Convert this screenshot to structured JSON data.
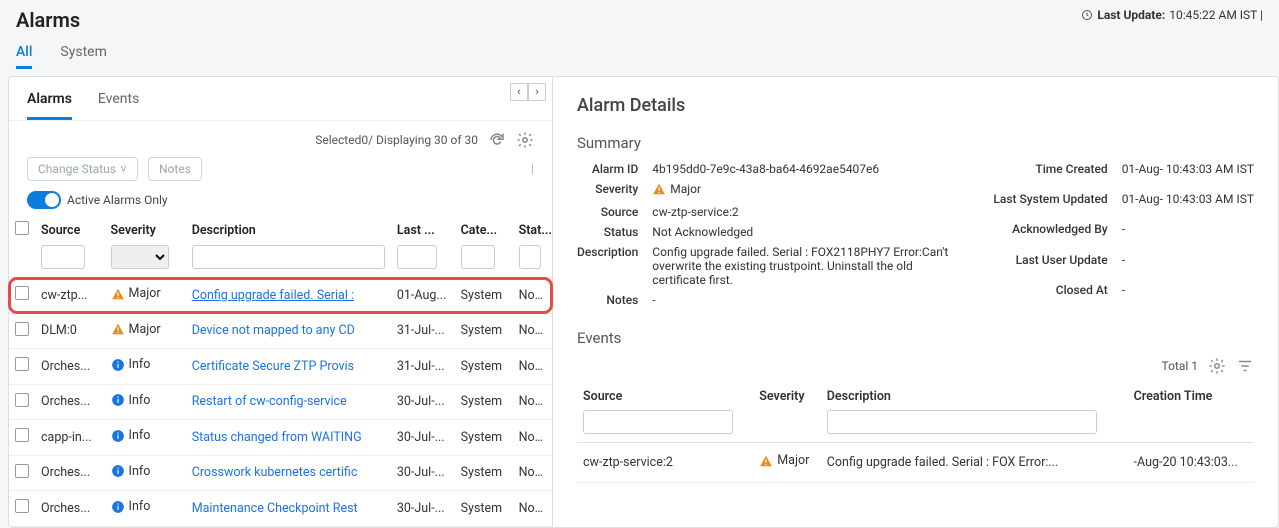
{
  "title": "Alarms",
  "last_update_label": "Last Update:",
  "last_update_value": "10:45:22 AM IST |",
  "top_tabs": {
    "all": "All",
    "system": "System"
  },
  "inner_tabs": {
    "alarms": "Alarms",
    "events": "Events"
  },
  "counts": "Selected0/ Displaying 30 of 30",
  "change_status": "Change Status",
  "notes_btn": "Notes",
  "active_toggle": "Active Alarms Only",
  "cols": {
    "source": "Source",
    "severity": "Severity",
    "description": "Description",
    "last": "Last ...",
    "category": "Cate...",
    "status": "Stat..."
  },
  "sev": {
    "major": "Major",
    "info": "Info"
  },
  "rows": [
    {
      "source": "cw-ztp...",
      "sev": "major",
      "desc": "Config upgrade failed. Serial :",
      "desc_underline": true,
      "last": "01-Aug...",
      "cat": "System",
      "stat": "Not A"
    },
    {
      "source": "DLM:0",
      "sev": "major",
      "desc": "Device not mapped to any CD",
      "last": "31-Jul-...",
      "cat": "System",
      "stat": "Not A"
    },
    {
      "source": "Orches...",
      "sev": "info",
      "desc": "Certificate Secure ZTP Provis",
      "last": "31-Jul-...",
      "cat": "System",
      "stat": "Not A"
    },
    {
      "source": "Orches...",
      "sev": "info",
      "desc": "Restart of cw-config-service",
      "last": "30-Jul-...",
      "cat": "System",
      "stat": "Not A"
    },
    {
      "source": "capp-in...",
      "sev": "info",
      "desc": "Status changed from WAITING",
      "last": "30-Jul-...",
      "cat": "System",
      "stat": "Not A"
    },
    {
      "source": "Orches...",
      "sev": "info",
      "desc": "Crosswork kubernetes certific",
      "last": "30-Jul-...",
      "cat": "System",
      "stat": "Not A"
    },
    {
      "source": "Orches...",
      "sev": "info",
      "desc": "Maintenance Checkpoint Rest",
      "last": "30-Jul-...",
      "cat": "System",
      "stat": "Not A"
    }
  ],
  "details": {
    "title": "Alarm Details",
    "summary_h": "Summary",
    "left": {
      "alarm_id_k": "Alarm ID",
      "alarm_id_v": "4b195dd0-7e9c-43a8-ba64-4692ae5407e6",
      "severity_k": "Severity",
      "severity_v": "Major",
      "source_k": "Source",
      "source_v": "cw-ztp-service:2",
      "status_k": "Status",
      "status_v": "Not Acknowledged",
      "desc_k": "Description",
      "desc_v": "Config upgrade failed. Serial : FOX2118PHY7 Error:Can't overwrite the existing trustpoint. Uninstall the old certificate first.",
      "notes_k": "Notes",
      "notes_v": "-"
    },
    "right": {
      "time_created_k": "Time Created",
      "time_created_v": "01-Aug-        10:43:03 AM IST",
      "last_sys_k": "Last System Updated",
      "last_sys_v": "01-Aug-        10:43:03 AM IST",
      "ack_by_k": "Acknowledged By",
      "ack_by_v": "-",
      "last_user_k": "Last User Update",
      "last_user_v": "-",
      "closed_k": "Closed At",
      "closed_v": "-"
    }
  },
  "events": {
    "h": "Events",
    "total": "Total 1",
    "cols": {
      "source": "Source",
      "severity": "Severity",
      "description": "Description",
      "creation": "Creation Time"
    },
    "row": {
      "source": "cw-ztp-service:2",
      "sev": "Major",
      "desc": "Config upgrade failed. Serial : FOX              Error:...",
      "time": "-Aug-20     10:43:03..."
    }
  }
}
